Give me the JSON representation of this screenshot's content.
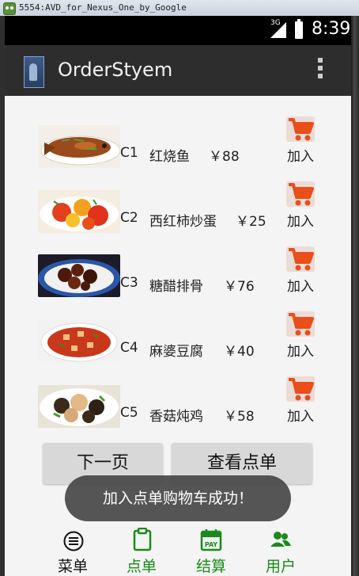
{
  "window": {
    "title": "5554:AVD_for_Nexus_One_by_Google"
  },
  "status_bar": {
    "network": "3G",
    "time": "8:39"
  },
  "action_bar": {
    "title": "OrderStyem",
    "icon": "app-icon",
    "overflow_icon": "overflow-menu-icon"
  },
  "dishes": [
    {
      "code": "C1",
      "name": "红烧鱼",
      "price": "￥88",
      "add_label": "加入",
      "cart_icon": "shopping-cart-icon"
    },
    {
      "code": "C2",
      "name": "西红柿炒蛋",
      "price": "￥25",
      "add_label": "加入",
      "cart_icon": "shopping-cart-icon"
    },
    {
      "code": "C3",
      "name": "糖醋排骨",
      "price": "￥76",
      "add_label": "加入",
      "cart_icon": "shopping-cart-icon"
    },
    {
      "code": "C4",
      "name": "麻婆豆腐",
      "price": "￥40",
      "add_label": "加入",
      "cart_icon": "shopping-cart-icon"
    },
    {
      "code": "C5",
      "name": "香菇炖鸡",
      "price": "￥58",
      "add_label": "加入",
      "cart_icon": "shopping-cart-icon"
    }
  ],
  "buttons": {
    "next_page": "下一页",
    "view_order": "查看点单"
  },
  "toast": {
    "message": "加入点单购物车成功！"
  },
  "tabs": [
    {
      "label": "菜单",
      "icon": "menu-list-icon",
      "selected": false
    },
    {
      "label": "点单",
      "icon": "clipboard-icon",
      "selected": true
    },
    {
      "label": "结算",
      "icon": "pay-calendar-icon",
      "selected": false
    },
    {
      "label": "用户",
      "icon": "users-icon",
      "selected": false
    }
  ],
  "colors": {
    "accent": "#e94e1b",
    "tab_active": "#1a8a1a",
    "tab_inactive": "#111111",
    "action_bar": "#2d2d2d"
  }
}
